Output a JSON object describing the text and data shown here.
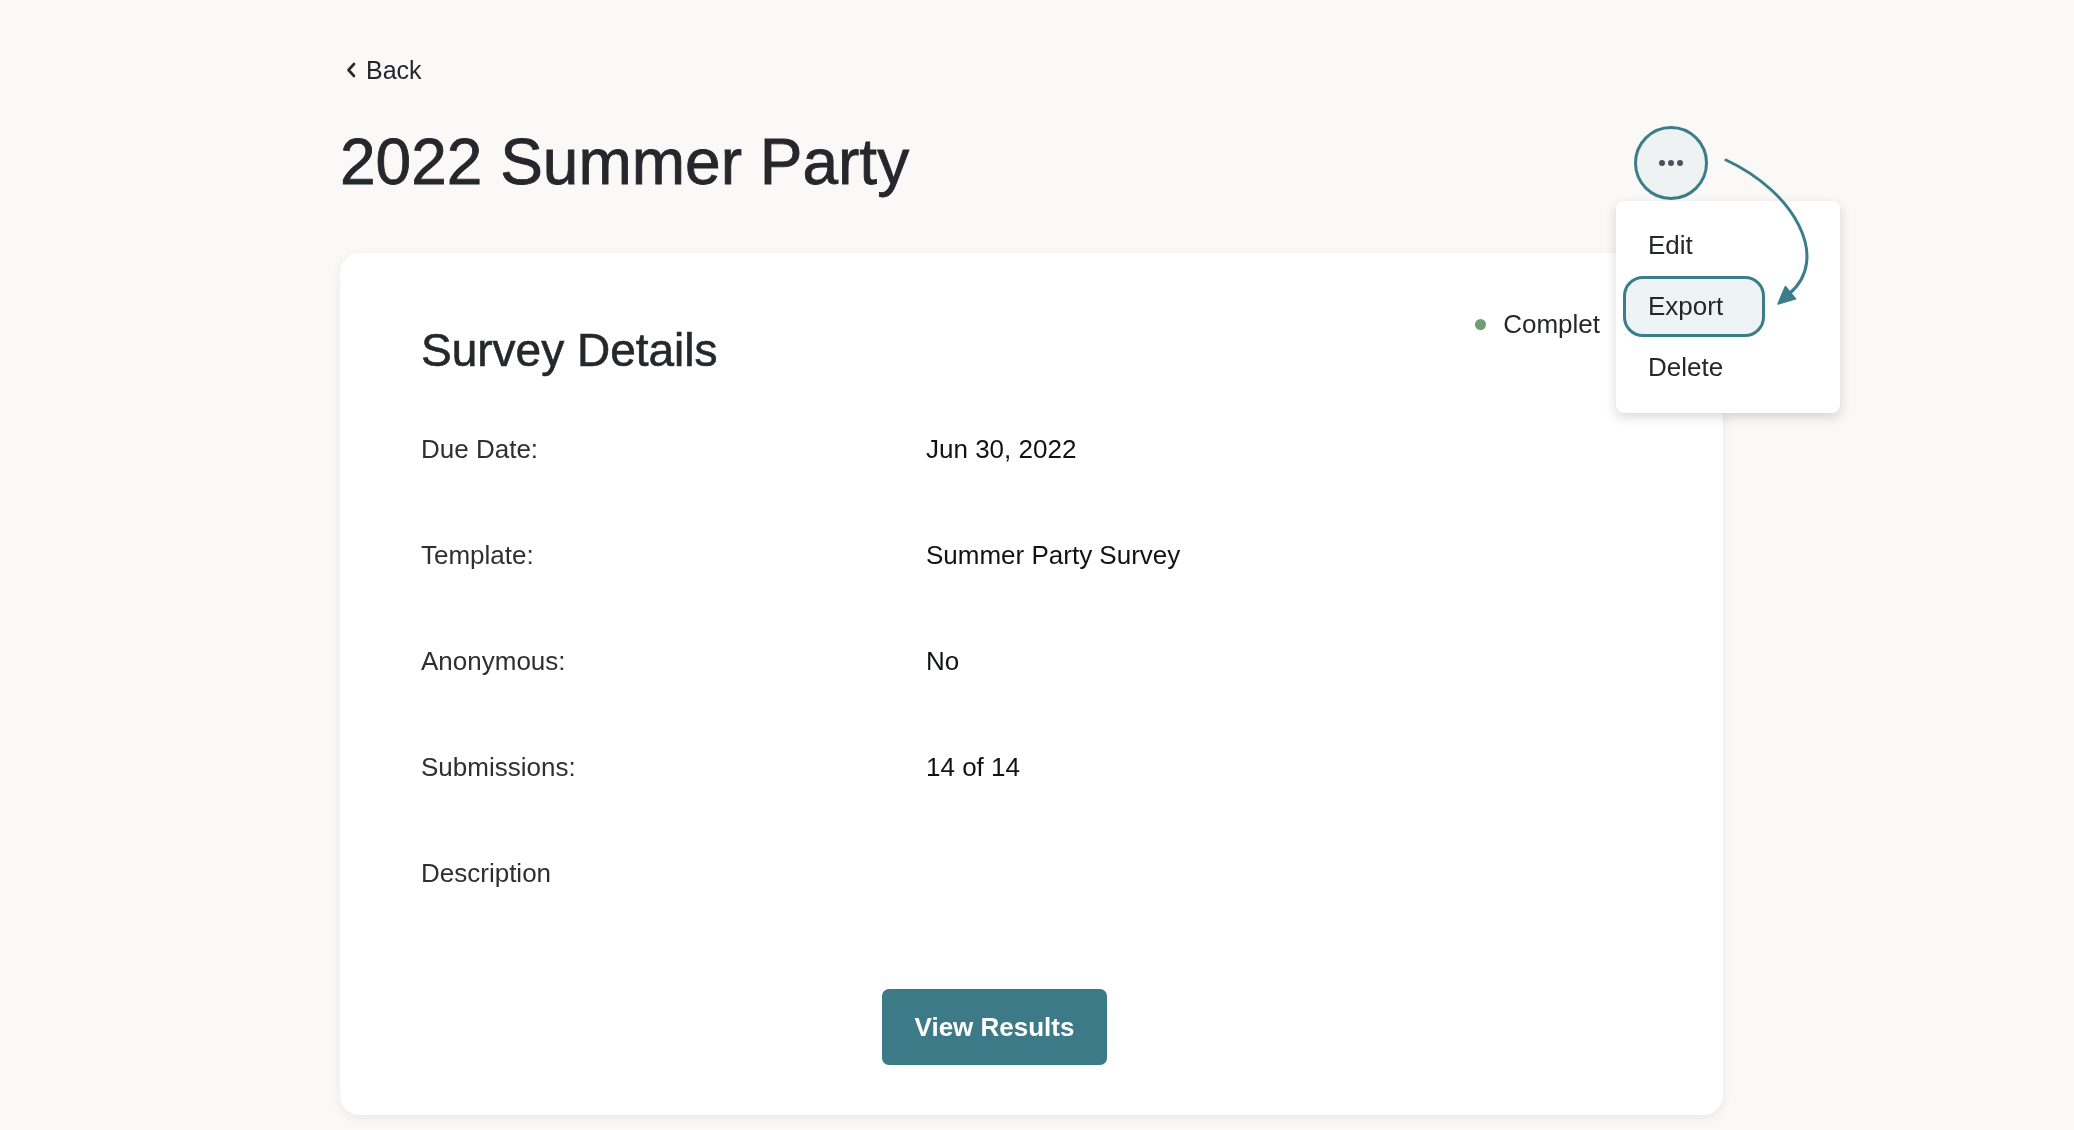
{
  "back_link": {
    "label": "Back"
  },
  "page_title": "2022 Summer Party",
  "more_menu": {
    "expanded": true,
    "items": [
      {
        "label": "Edit",
        "selected": false
      },
      {
        "label": "Export",
        "selected": true
      },
      {
        "label": "Delete",
        "selected": false
      }
    ]
  },
  "details_card": {
    "title": "Survey Details",
    "status": {
      "label": "Complet",
      "color": "#6e9e74"
    },
    "fields": [
      {
        "label": "Due Date:",
        "value": "Jun 30, 2022"
      },
      {
        "label": "Template:",
        "value": "Summer Party Survey"
      },
      {
        "label": "Anonymous:",
        "value": "No"
      },
      {
        "label": "Submissions:",
        "value": "14 of 14"
      },
      {
        "label": "Description"
      }
    ],
    "primary_button": "View Results"
  }
}
